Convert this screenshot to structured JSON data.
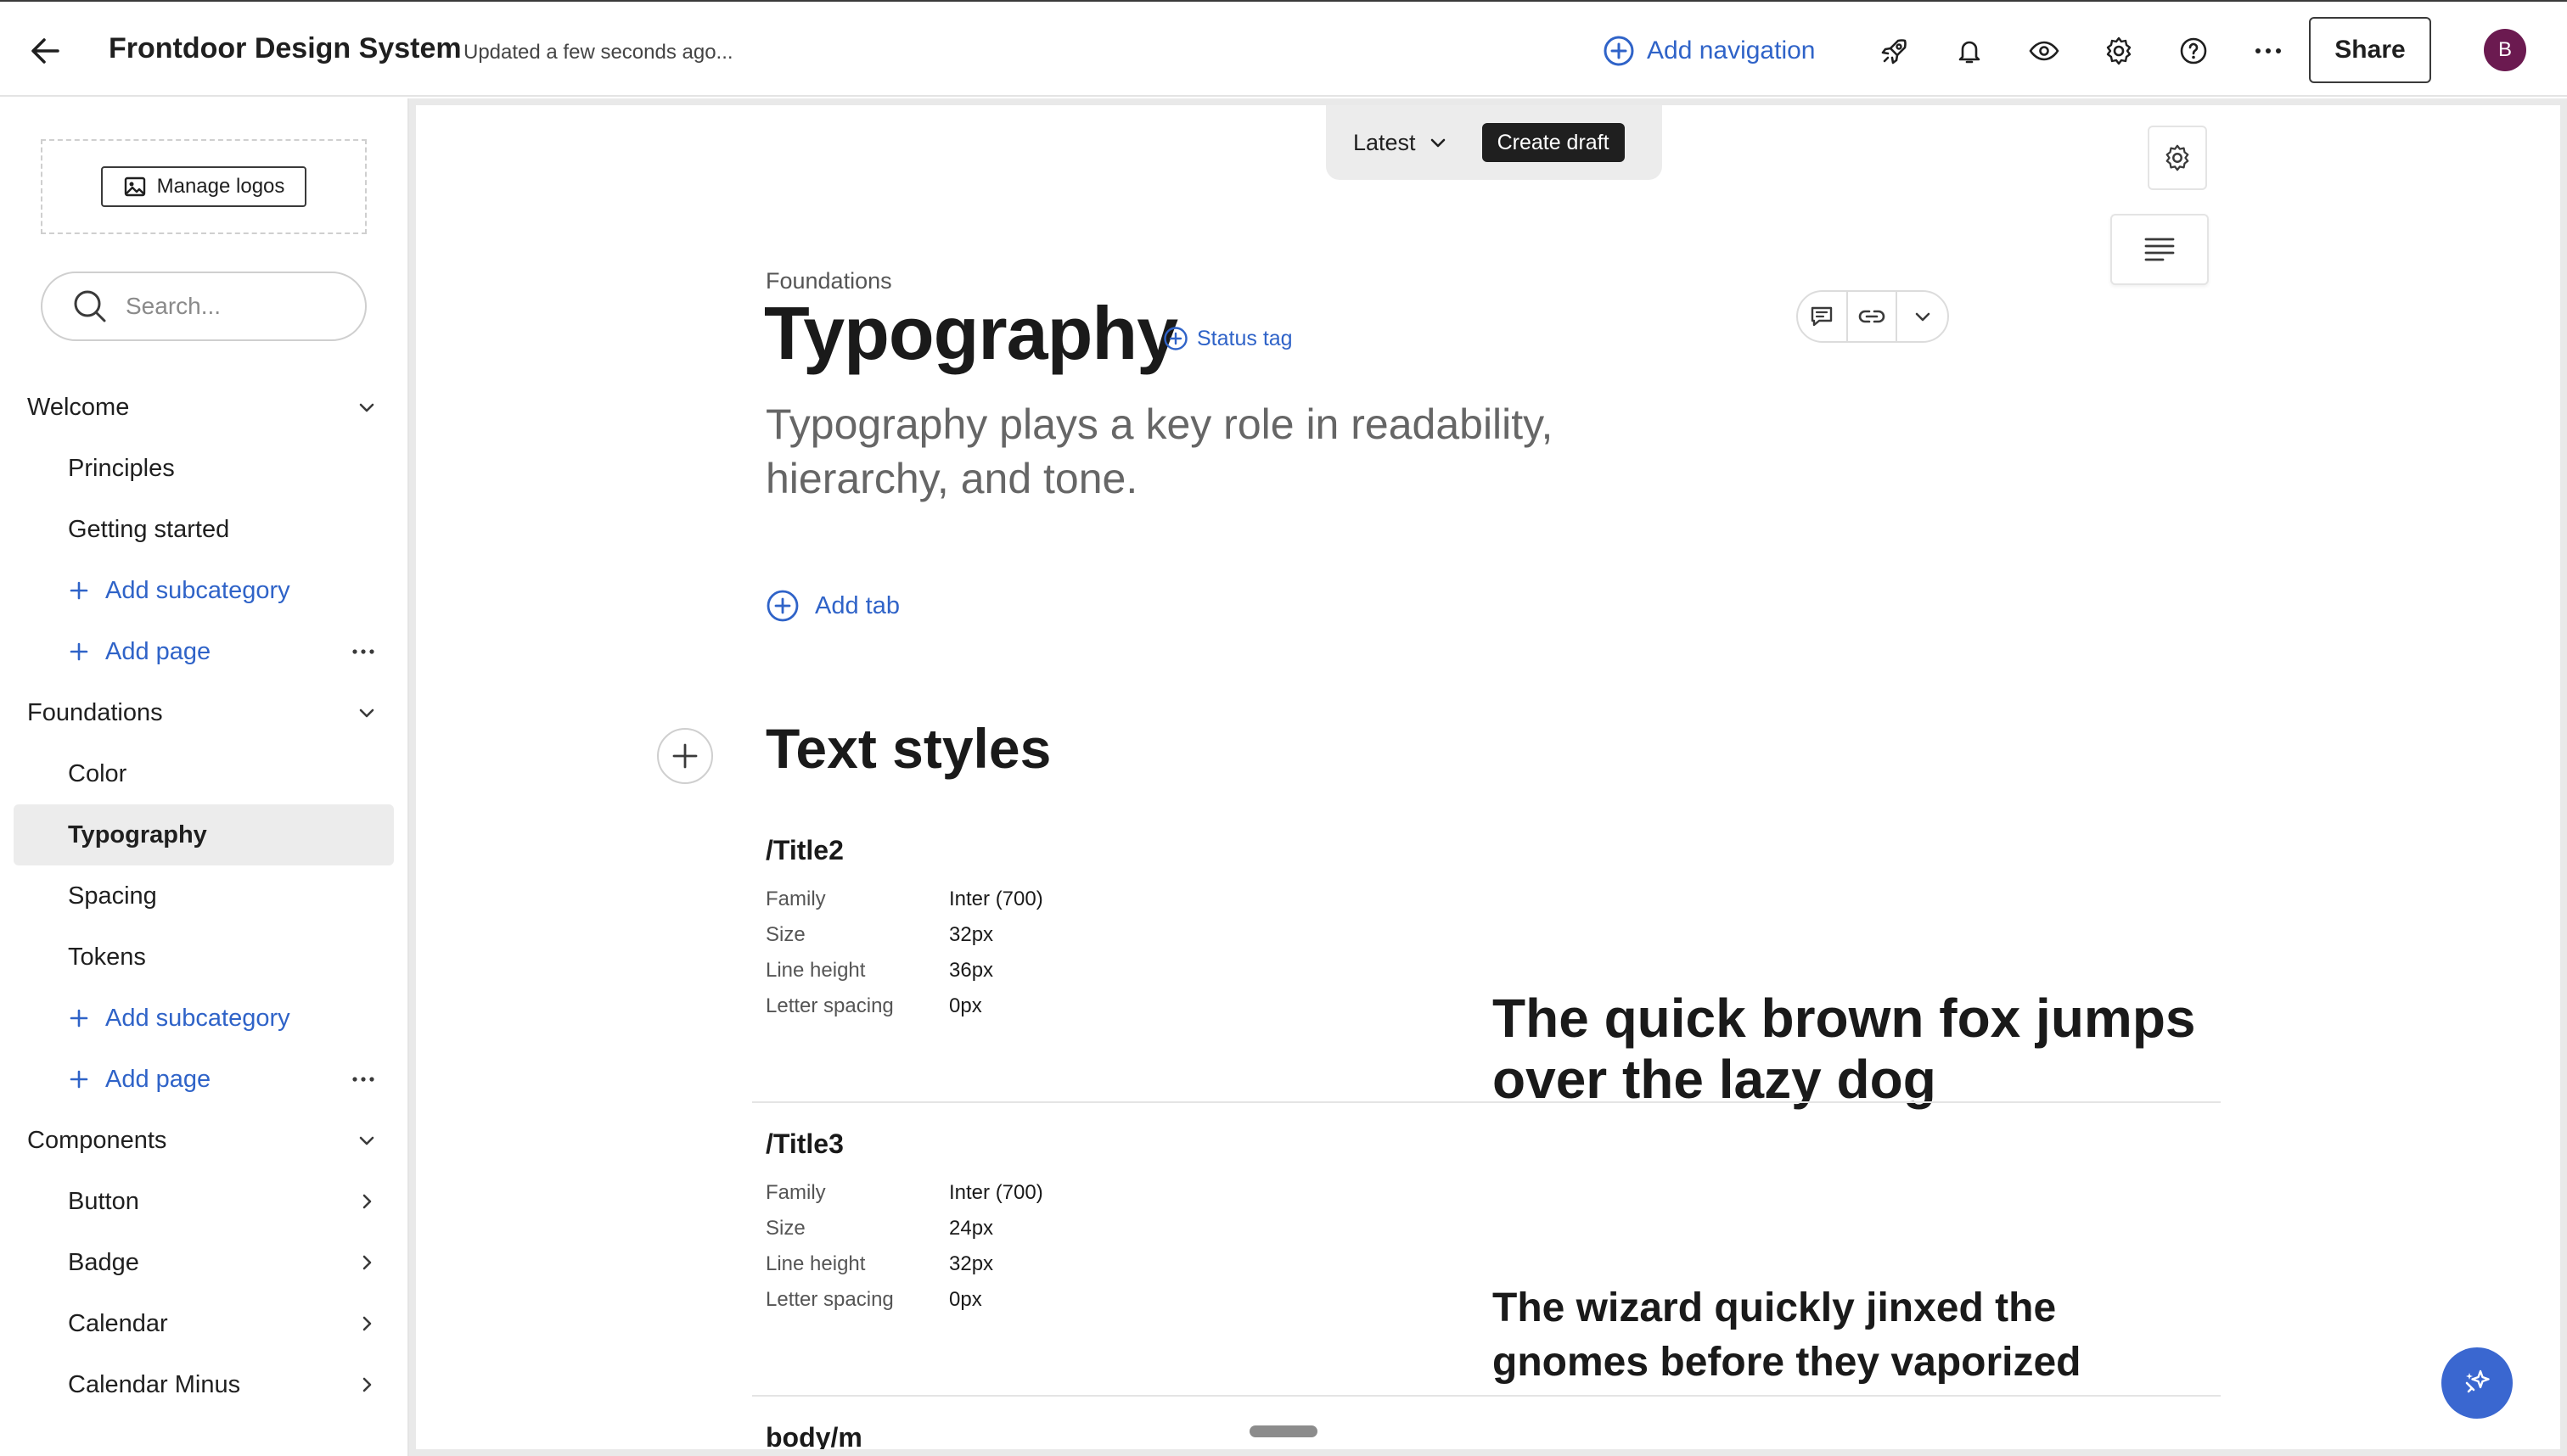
{
  "header": {
    "title": "Frontdoor Design System",
    "updated": "Updated a few seconds ago...",
    "add_navigation": "Add navigation",
    "share": "Share",
    "avatar_initial": "B",
    "icons": [
      "back-arrow-icon",
      "plus-circle-icon",
      "rocket-icon",
      "bell-icon",
      "eye-icon",
      "gear-icon",
      "help-icon",
      "more-icon"
    ]
  },
  "sidebar": {
    "manage_logos": "Manage logos",
    "search_placeholder": "Search...",
    "welcome": {
      "label": "Welcome",
      "items": [
        "Principles",
        "Getting started"
      ],
      "add_subcategory": "Add subcategory",
      "add_page": "Add page"
    },
    "foundations": {
      "label": "Foundations",
      "items": [
        "Color",
        "Typography",
        "Spacing",
        "Tokens"
      ],
      "active": "Typography",
      "add_subcategory": "Add subcategory",
      "add_page": "Add page"
    },
    "components": {
      "label": "Components",
      "items": [
        "Button",
        "Badge",
        "Calendar",
        "Calendar Minus"
      ]
    }
  },
  "toolbar": {
    "version": "Latest",
    "create_draft": "Create draft"
  },
  "page": {
    "breadcrumb": "Foundations",
    "title": "Typography",
    "status_tag": "Status tag",
    "description": "Typography plays a key role in readability, hierarchy, and tone.",
    "add_tab": "Add tab",
    "section_title": "Text styles",
    "spec_labels": {
      "family": "Family",
      "size": "Size",
      "line_height": "Line height",
      "letter_spacing": "Letter spacing"
    },
    "styles": [
      {
        "name": "/Title2",
        "family": "Inter (700)",
        "size": "32px",
        "line_height": "36px",
        "letter_spacing": "0px",
        "sample": "The quick brown fox jumps over the lazy dog"
      },
      {
        "name": "/Title3",
        "family": "Inter (700)",
        "size": "24px",
        "line_height": "32px",
        "letter_spacing": "0px",
        "sample": "The wizard quickly jinxed the gnomes before they vaporized"
      },
      {
        "name": "body/m"
      }
    ]
  },
  "colors": {
    "accent": "#2f63c8",
    "active_bg": "#ececec",
    "avatar": "#6b1a50",
    "ai_button": "#3a67d0"
  }
}
